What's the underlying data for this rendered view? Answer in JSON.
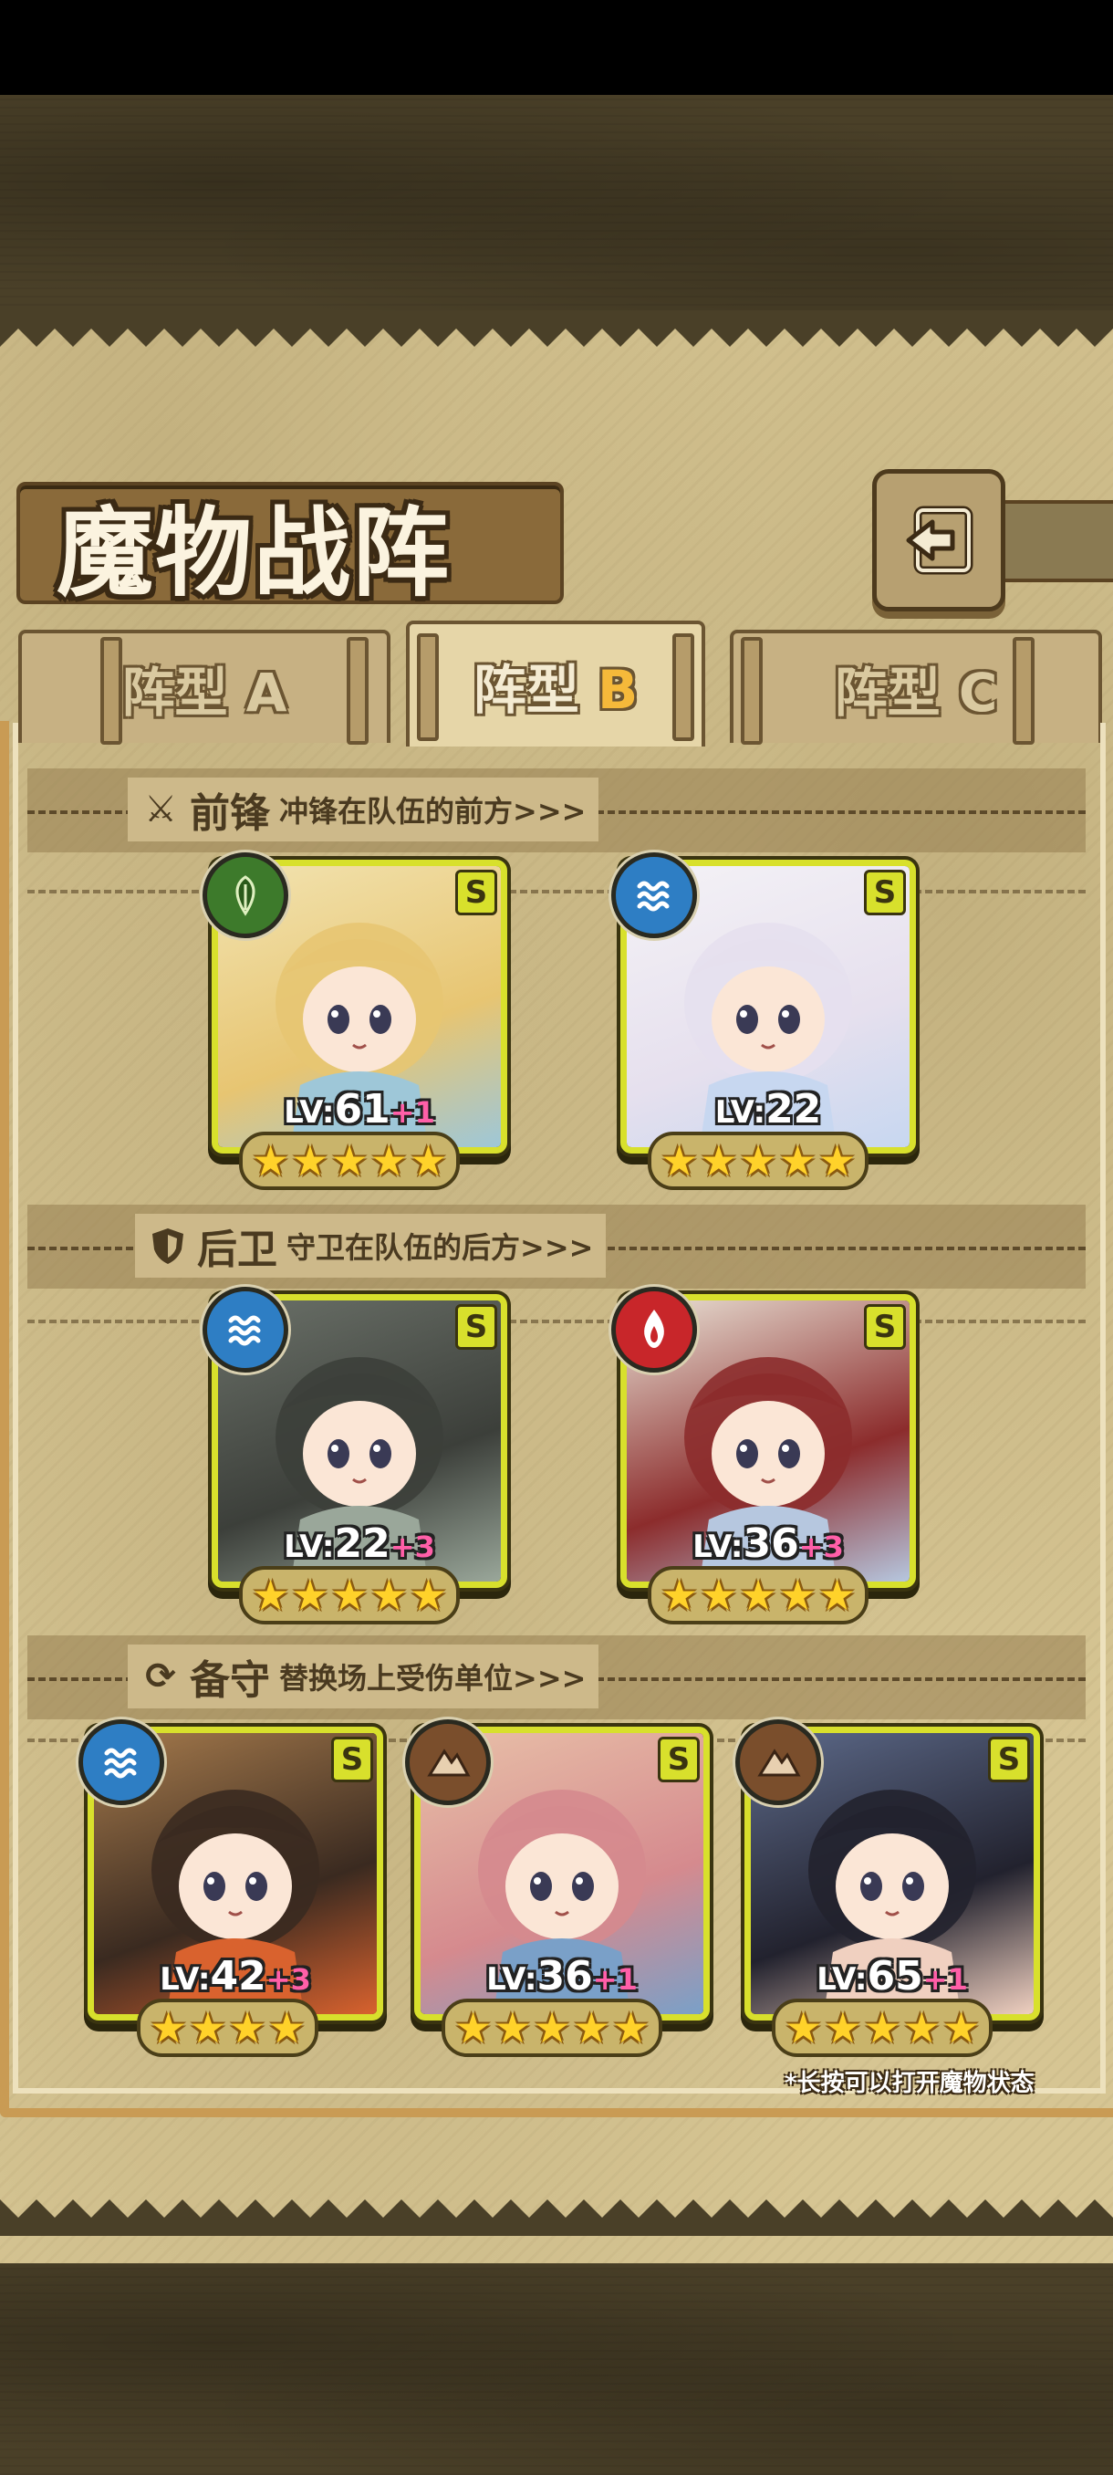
{
  "header": {
    "title": "魔物战阵",
    "back_icon": "back-arrow-icon"
  },
  "tabs": [
    {
      "label": "阵型",
      "letter": "A",
      "active": false
    },
    {
      "label": "阵型",
      "letter": "B",
      "active": true
    },
    {
      "label": "阵型",
      "letter": "C",
      "active": false
    }
  ],
  "sections": {
    "front": {
      "title": "前锋",
      "subtitle": "冲锋在队伍的前方>>>",
      "icon": "sword-icon"
    },
    "rear": {
      "title": "后卫",
      "subtitle": "守卫在队伍的后方>>>",
      "icon": "shield-icon"
    },
    "reserve": {
      "title": "备守",
      "subtitle": "替换场上受伤单位>>>",
      "icon": "swap-icon"
    }
  },
  "cards": {
    "front_1": {
      "rank": "S",
      "element": "leaf",
      "lv_prefix": "LV:",
      "level": "61",
      "bonus": "+1",
      "stars": 5
    },
    "front_2": {
      "rank": "S",
      "element": "water",
      "lv_prefix": "LV:",
      "level": "22",
      "bonus": "",
      "stars": 5
    },
    "rear_1": {
      "rank": "S",
      "element": "water",
      "lv_prefix": "LV:",
      "level": "22",
      "bonus": "+3",
      "stars": 5
    },
    "rear_2": {
      "rank": "S",
      "element": "fire",
      "lv_prefix": "LV:",
      "level": "36",
      "bonus": "+3",
      "stars": 5
    },
    "reserve_1": {
      "rank": "S",
      "element": "water",
      "lv_prefix": "LV:",
      "level": "42",
      "bonus": "+3",
      "stars": 4
    },
    "reserve_2": {
      "rank": "S",
      "element": "earth",
      "lv_prefix": "LV:",
      "level": "36",
      "bonus": "+1",
      "stars": 5
    },
    "reserve_3": {
      "rank": "S",
      "element": "earth",
      "lv_prefix": "LV:",
      "level": "65",
      "bonus": "+1",
      "stars": 5
    }
  },
  "hint": "*长按可以打开魔物状态",
  "colors": {
    "card_border": "#d8e02c",
    "star": "#ffd22a",
    "bonus": "#ff5fa8",
    "active_tab_letter": "#f5b93a"
  }
}
